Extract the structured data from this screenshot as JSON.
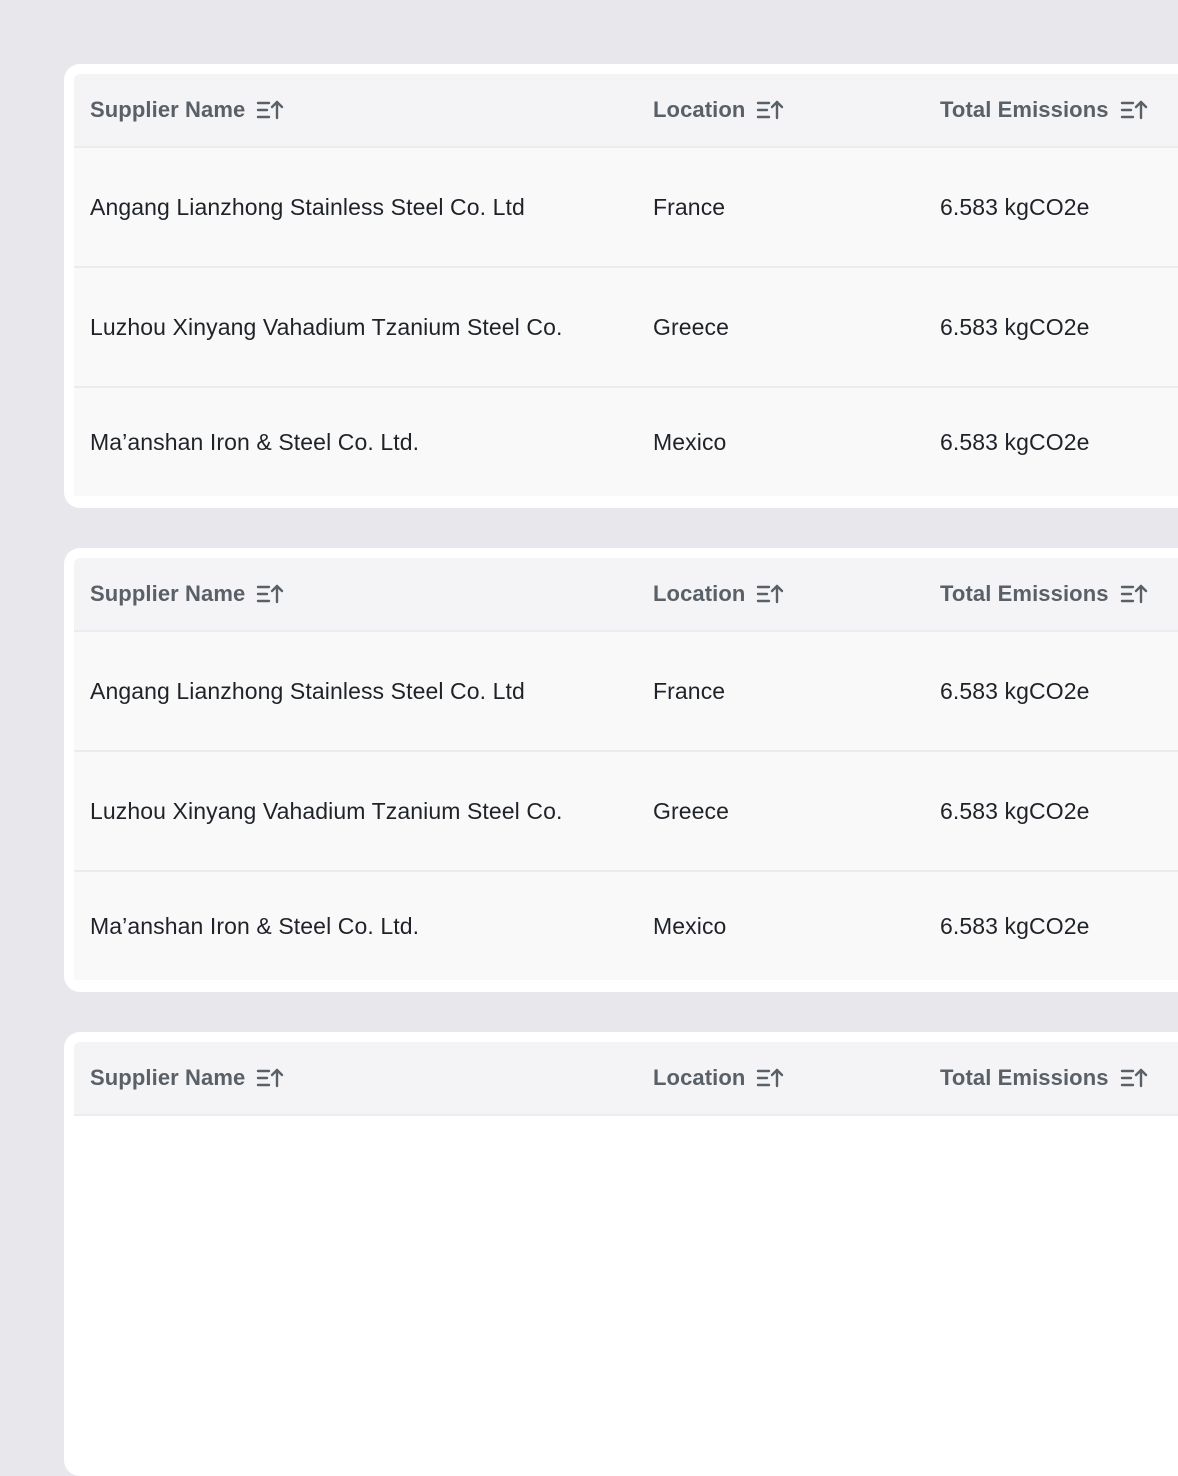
{
  "columns": {
    "supplier": "Supplier Name",
    "location": "Location",
    "emissions": "Total Emissions"
  },
  "tables": [
    {
      "rows": [
        {
          "supplier": "Angang Lianzhong Stainless Steel Co. Ltd",
          "location": "France",
          "emissions": "6.583 kgCO2e"
        },
        {
          "supplier": "Luzhou Xinyang Vahadium Tzanium Steel Co.",
          "location": "Greece",
          "emissions": "6.583 kgCO2e"
        },
        {
          "supplier": "Ma’anshan Iron & Steel Co. Ltd.",
          "location": "Mexico",
          "emissions": "6.583 kgCO2e"
        }
      ]
    },
    {
      "rows": [
        {
          "supplier": "Angang Lianzhong Stainless Steel Co. Ltd",
          "location": "France",
          "emissions": "6.583 kgCO2e"
        },
        {
          "supplier": "Luzhou Xinyang Vahadium Tzanium Steel Co.",
          "location": "Greece",
          "emissions": "6.583 kgCO2e"
        },
        {
          "supplier": "Ma’anshan Iron & Steel Co. Ltd.",
          "location": "Mexico",
          "emissions": "6.583 kgCO2e"
        }
      ]
    },
    {
      "rows": []
    }
  ],
  "icons": {
    "sort": "sort-ascending-icon"
  },
  "colors": {
    "background": "#e8e7ec",
    "card": "#ffffff",
    "header": "#f4f4f6",
    "row": "#f9f9fa",
    "header_text": "#5a6068",
    "body_text": "#1f2328"
  }
}
